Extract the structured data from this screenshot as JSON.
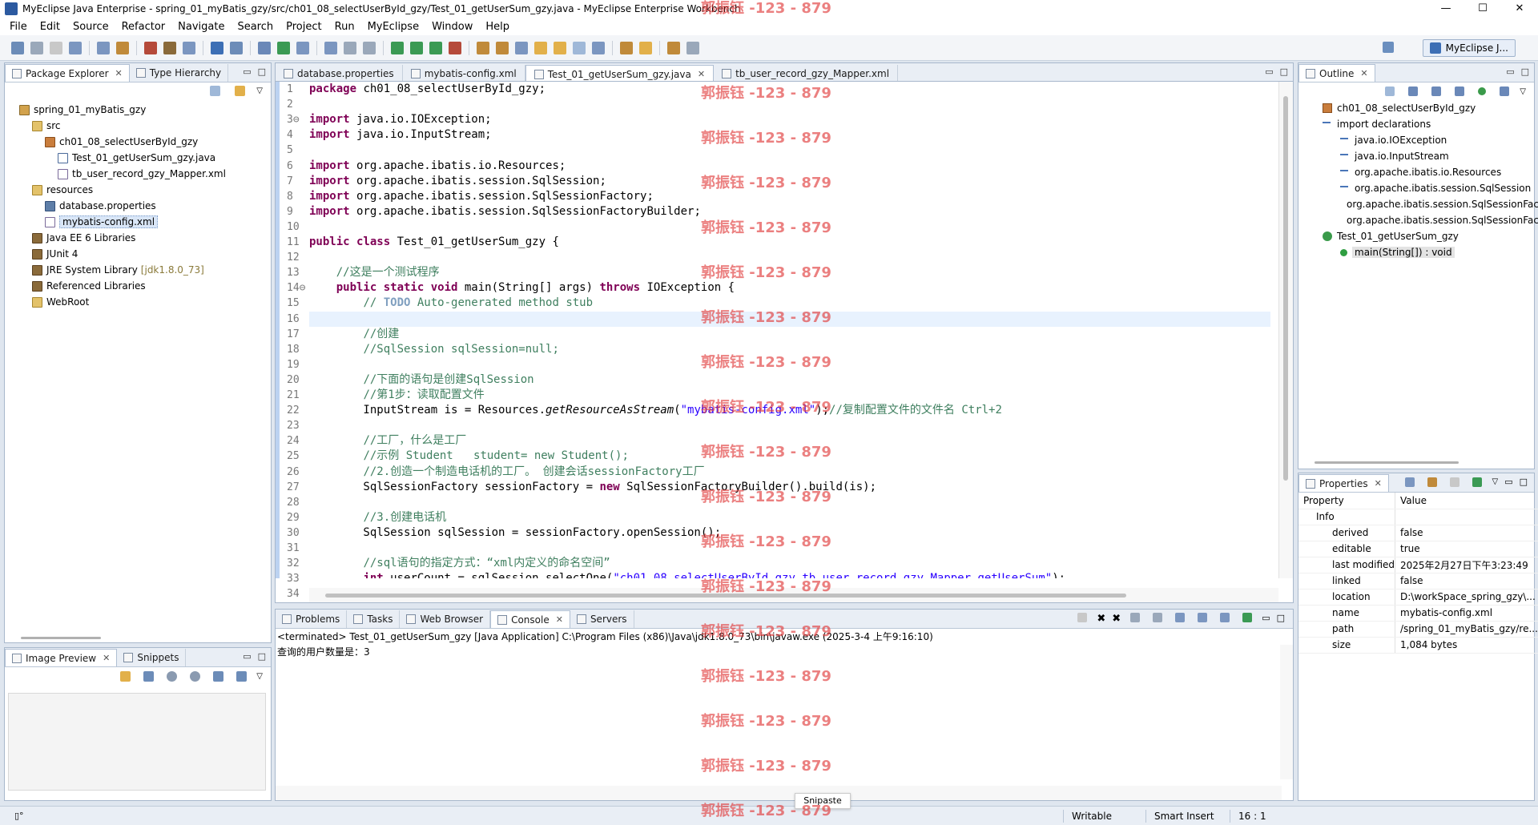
{
  "window": {
    "title": "MyEclipse Java Enterprise - spring_01_myBatis_gzy/src/ch01_08_selectUserById_gzy/Test_01_getUserSum_gzy.java - MyEclipse Enterprise Workbench",
    "controls": {
      "minimize": "—",
      "maximize": "☐",
      "close": "✕"
    }
  },
  "menu": [
    "File",
    "Edit",
    "Source",
    "Refactor",
    "Navigate",
    "Search",
    "Project",
    "Run",
    "MyEclipse",
    "Window",
    "Help"
  ],
  "perspective": {
    "label": "MyEclipse J..."
  },
  "package_explorer": {
    "tabs": [
      "Package Explorer",
      "Type Hierarchy"
    ],
    "tree": [
      {
        "label": "spring_01_myBatis_gzy",
        "icon": "project-icon",
        "depth": 0
      },
      {
        "label": "src",
        "icon": "source-folder-icon",
        "depth": 1
      },
      {
        "label": "ch01_08_selectUserById_gzy",
        "icon": "package-icon",
        "depth": 2
      },
      {
        "label": "Test_01_getUserSum_gzy.java",
        "icon": "java-file-icon",
        "depth": 3
      },
      {
        "label": "tb_user_record_gzy_Mapper.xml",
        "icon": "xml-file-icon",
        "depth": 3
      },
      {
        "label": "resources",
        "icon": "source-folder-icon",
        "depth": 1
      },
      {
        "label": "database.properties",
        "icon": "properties-file-icon",
        "depth": 2
      },
      {
        "label": "mybatis-config.xml",
        "icon": "xml-file-icon",
        "depth": 2,
        "selected": true
      },
      {
        "label": "Java EE 6 Libraries",
        "icon": "library-icon",
        "depth": 1
      },
      {
        "label": "JUnit 4",
        "icon": "library-icon",
        "depth": 1
      },
      {
        "label": "JRE System Library",
        "suffix": "[jdk1.8.0_73]",
        "icon": "library-icon",
        "depth": 1
      },
      {
        "label": "Referenced Libraries",
        "icon": "library-icon",
        "depth": 1
      },
      {
        "label": "WebRoot",
        "icon": "folder-icon",
        "depth": 1
      }
    ]
  },
  "image_preview": {
    "tabs": [
      "Image Preview",
      "Snippets"
    ]
  },
  "editor": {
    "tabs": [
      {
        "label": "database.properties",
        "active": false
      },
      {
        "label": "mybatis-config.xml",
        "active": false
      },
      {
        "label": "Test_01_getUserSum_gzy.java",
        "active": true
      },
      {
        "label": "tb_user_record_gzy_Mapper.xml",
        "active": false
      }
    ],
    "current_line": 16,
    "lines": [
      {
        "n": "1",
        "html": "<span class='kw'>package</span> ch01_08_selectUserById_gzy;"
      },
      {
        "n": "2",
        "html": ""
      },
      {
        "n": "3⊖",
        "html": "<span class='kw'>import</span> java.io.IOException;"
      },
      {
        "n": "4",
        "html": "<span class='kw'>import</span> java.io.InputStream;"
      },
      {
        "n": "5",
        "html": ""
      },
      {
        "n": "6",
        "html": "<span class='kw'>import</span> org.apache.ibatis.io.Resources;"
      },
      {
        "n": "7",
        "html": "<span class='kw'>import</span> org.apache.ibatis.session.SqlSession;"
      },
      {
        "n": "8",
        "html": "<span class='kw'>import</span> org.apache.ibatis.session.SqlSessionFactory;"
      },
      {
        "n": "9",
        "html": "<span class='kw'>import</span> org.apache.ibatis.session.SqlSessionFactoryBuilder;"
      },
      {
        "n": "10",
        "html": ""
      },
      {
        "n": "11",
        "html": "<span class='kw'>public class</span> Test_01_getUserSum_gzy {"
      },
      {
        "n": "12",
        "html": ""
      },
      {
        "n": "13",
        "html": "    <span class='cm'>//这是一个测试程序</span>"
      },
      {
        "n": "14⊖",
        "html": "    <span class='kw'>public static void</span> main(String[] args) <span class='kw'>throws</span> IOException {"
      },
      {
        "n": "15",
        "html": "        <span class='cm'>// <span class='todo'>TODO</span> Auto-generated method stub</span>"
      },
      {
        "n": "16",
        "html": ""
      },
      {
        "n": "17",
        "html": "        <span class='cm'>//创建</span>"
      },
      {
        "n": "18",
        "html": "        <span class='cm'>//SqlSession sqlSession=null;</span>"
      },
      {
        "n": "19",
        "html": ""
      },
      {
        "n": "20",
        "html": "        <span class='cm'>//下面的语句是创建SqlSession</span>"
      },
      {
        "n": "21",
        "html": "        <span class='cm'>//第1步：读取配置文件</span>"
      },
      {
        "n": "22",
        "html": "        InputStream is = Resources.<span class='it'>getResourceAsStream</span>(<span class='st'>\"mybatis-config.xml\"</span>);<span class='cm'>//复制配置文件的文件名 Ctrl+2</span>"
      },
      {
        "n": "23",
        "html": ""
      },
      {
        "n": "24",
        "html": "        <span class='cm'>//工厂，什么是工厂</span>"
      },
      {
        "n": "25",
        "html": "        <span class='cm'>//示例 Student   student= new Student();</span>"
      },
      {
        "n": "26",
        "html": "        <span class='cm'>//2.创造一个制造电话机的工厂。 创建会话sessionFactory工厂</span>"
      },
      {
        "n": "27",
        "html": "        SqlSessionFactory sessionFactory = <span class='kw'>new</span> SqlSessionFactoryBuilder().build(is);"
      },
      {
        "n": "28",
        "html": ""
      },
      {
        "n": "29",
        "html": "        <span class='cm'>//3.创建电话机</span>"
      },
      {
        "n": "30",
        "html": "        SqlSession sqlSession = sessionFactory.openSession();"
      },
      {
        "n": "31",
        "html": ""
      },
      {
        "n": "32",
        "html": "        <span class='cm'>//sql语句的指定方式：“xml内定义的命名空间”</span>"
      },
      {
        "n": "33",
        "html": "        <span class='kw'>int</span> userCount = sqlSession.selectOne(<span class='st'>\"ch01_08_selectUserById_gzy.tb_user_record_gzy_Mapper.getUserSum\"</span>);"
      },
      {
        "n": "34",
        "html": ""
      }
    ]
  },
  "console": {
    "tabs": [
      "Problems",
      "Tasks",
      "Web Browser",
      "Console",
      "Servers"
    ],
    "header": "<terminated> Test_01_getUserSum_gzy [Java Application] C:\\Program Files (x86)\\Java\\jdk1.8.0_73\\bin\\javaw.exe (2025-3-4 上午9:16:10)",
    "output": "查询的用户数量是：3"
  },
  "outline": {
    "tab": "Outline",
    "items": [
      {
        "label": "ch01_08_selectUserById_gzy",
        "icon": "package-icon",
        "depth": 0
      },
      {
        "label": "import declarations",
        "icon": "imports-icon",
        "depth": 0
      },
      {
        "label": "java.io.IOException",
        "icon": "import-icon",
        "depth": 1
      },
      {
        "label": "java.io.InputStream",
        "icon": "import-icon",
        "depth": 1
      },
      {
        "label": "org.apache.ibatis.io.Resources",
        "icon": "import-icon",
        "depth": 1
      },
      {
        "label": "org.apache.ibatis.session.SqlSession",
        "icon": "import-icon",
        "depth": 1
      },
      {
        "label": "org.apache.ibatis.session.SqlSessionFactory",
        "icon": "import-icon",
        "depth": 1
      },
      {
        "label": "org.apache.ibatis.session.SqlSessionFactoryBuilder",
        "icon": "import-icon",
        "depth": 1
      },
      {
        "label": "Test_01_getUserSum_gzy",
        "icon": "class-icon",
        "depth": 0
      },
      {
        "label": "main(String[]) : void",
        "icon": "method-icon",
        "depth": 1,
        "selected": true
      }
    ]
  },
  "properties": {
    "tab": "Properties",
    "col_property": "Property",
    "col_value": "Value",
    "group": "Info",
    "rows": [
      {
        "k": "derived",
        "v": "false"
      },
      {
        "k": "editable",
        "v": "true"
      },
      {
        "k": "last modified",
        "v": "2025年2月27日下午3:23:49"
      },
      {
        "k": "linked",
        "v": "false"
      },
      {
        "k": "location",
        "v": "D:\\workSpace_spring_gzy\\..."
      },
      {
        "k": "name",
        "v": "mybatis-config.xml"
      },
      {
        "k": "path",
        "v": "/spring_01_myBatis_gzy/re..."
      },
      {
        "k": "size",
        "v": "1,084  bytes"
      }
    ]
  },
  "status": {
    "writable": "Writable",
    "insert": "Smart Insert",
    "position": "16 : 1"
  },
  "snipaste": "Snipaste",
  "watermark": "郭振钰 -123 - 879"
}
